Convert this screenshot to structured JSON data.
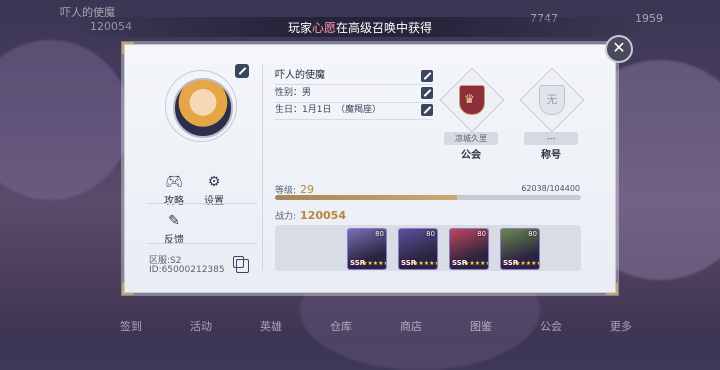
{
  "background": {
    "player_name": "吓人的使魔",
    "power_badge": "120054",
    "currency1": "7747",
    "currency2": "1959",
    "menu_items": [
      "签到",
      "活动",
      "英雄",
      "仓库",
      "商店",
      "图鉴",
      "公会",
      "更多"
    ]
  },
  "notice": {
    "prefix": "玩家",
    "player": "心愿",
    "suffix": "在高级召唤中获得"
  },
  "dialog": {
    "left_buttons": {
      "guide": "攻略",
      "settings": "设置",
      "feedback": "反馈"
    },
    "server": "区服:S2",
    "id": "ID:65000212385",
    "info": {
      "name": "吓人的使魔",
      "gender": "性别：男",
      "birthday": "生日：1月1日　（魔羯座）"
    },
    "guild": {
      "name": "凉城久里",
      "label": "公会"
    },
    "title": {
      "icon_text": "无",
      "name": "---",
      "label": "称号"
    },
    "level_label": "等级:",
    "level": "29",
    "exp": "62038/104400",
    "exp_ratio": 0.594,
    "power_label": "战力:",
    "power": "120054",
    "heroes": [
      {
        "level": "80",
        "rarity": "SSR",
        "stars": "★★★★★",
        "color": "#7a6fb8",
        "icon": "hero-portrait-1"
      },
      {
        "level": "80",
        "rarity": "SSR",
        "stars": "★★★★★",
        "color": "#5e4f9c",
        "icon": "hero-portrait-2"
      },
      {
        "level": "80",
        "rarity": "SSR",
        "stars": "★★★★★",
        "color": "#c0475a",
        "icon": "hero-portrait-3"
      },
      {
        "level": "80",
        "rarity": "SSR",
        "stars": "★★★★★",
        "color": "#6a8a4e",
        "icon": "hero-portrait-4"
      }
    ]
  },
  "colors": {
    "accent_gold": "#b9863a",
    "panel": "#eef0f5",
    "dark": "#3a4660"
  }
}
